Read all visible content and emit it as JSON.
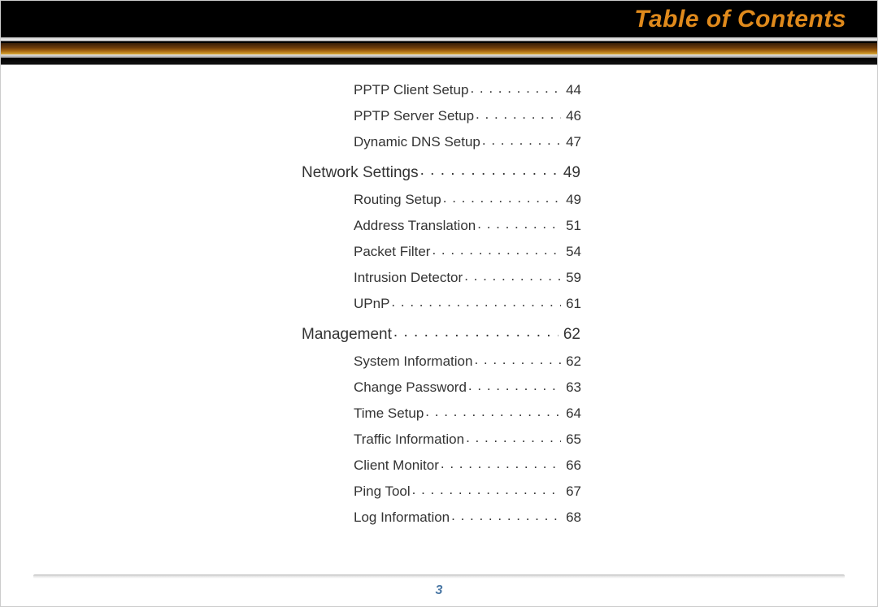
{
  "header": {
    "title": "Table of Contents"
  },
  "toc": {
    "orphan_subs": [
      {
        "label": "PPTP Client Setup",
        "page": "44"
      },
      {
        "label": "PPTP Server Setup",
        "page": "46"
      },
      {
        "label": "Dynamic DNS Setup",
        "page": "47"
      }
    ],
    "sections": [
      {
        "label": "Network Settings",
        "page": "49",
        "subs": [
          {
            "label": "Routing Setup",
            "page": "49"
          },
          {
            "label": "Address Translation",
            "page": "51"
          },
          {
            "label": "Packet Filter",
            "page": "54"
          },
          {
            "label": "Intrusion Detector",
            "page": "59"
          },
          {
            "label": "UPnP",
            "page": "61"
          }
        ]
      },
      {
        "label": "Management",
        "page": "62",
        "subs": [
          {
            "label": "System Information",
            "page": "62"
          },
          {
            "label": "Change Password",
            "page": "63"
          },
          {
            "label": "Time Setup",
            "page": "64"
          },
          {
            "label": "Traffic Information",
            "page": "65"
          },
          {
            "label": "Client Monitor",
            "page": "66"
          },
          {
            "label": "Ping Tool",
            "page": "67"
          },
          {
            "label": "Log Information",
            "page": "68"
          }
        ]
      }
    ]
  },
  "footer": {
    "page_number": "3"
  }
}
